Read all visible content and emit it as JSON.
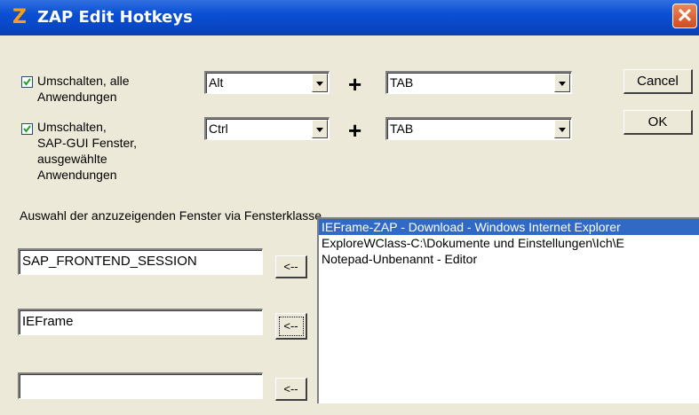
{
  "window": {
    "logo": "Z",
    "title": "ZAP Edit Hotkeys",
    "close_symbol": "✕"
  },
  "hotkeys": [
    {
      "checked": true,
      "label_lines": [
        "Umschalten, alle",
        "Anwendungen"
      ],
      "modifier": "Alt",
      "key": "TAB"
    },
    {
      "checked": true,
      "label_lines": [
        "Umschalten,",
        "SAP-GUI Fenster,",
        "ausgewählte",
        "Anwendungen"
      ],
      "modifier": "Ctrl",
      "key": "TAB"
    }
  ],
  "plus_symbol": "+",
  "buttons": {
    "cancel": "Cancel",
    "ok": "OK",
    "add": "<--"
  },
  "section_label": "Auswahl der anzuzeigenden Fenster via Fensterklasse",
  "class_fields": [
    "SAP_FRONTEND_SESSION",
    "IEFrame",
    ""
  ],
  "window_list": [
    "IEFrame-ZAP - Download - Windows Internet Explorer",
    "ExploreWClass-C:\\Dokumente und Einstellungen\\Ich\\E",
    "Notepad-Unbenannt - Editor"
  ]
}
